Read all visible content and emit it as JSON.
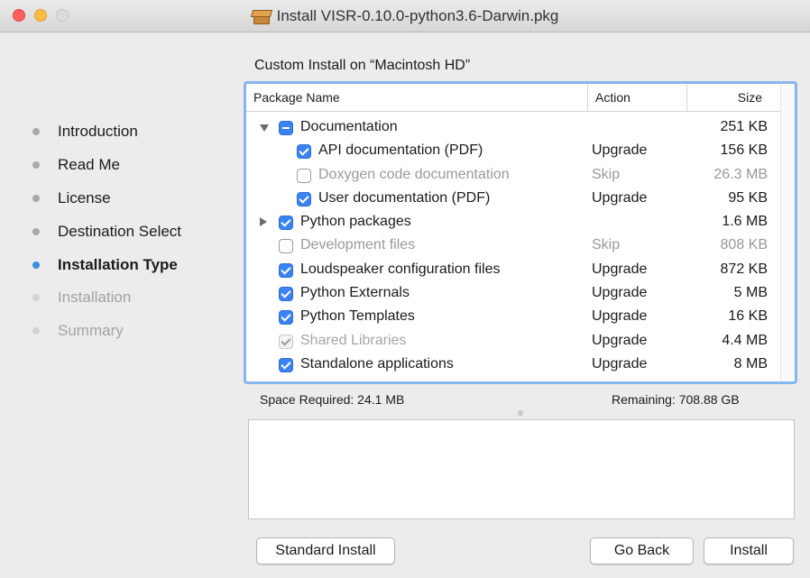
{
  "window": {
    "title": "Install VISR-0.10.0-python3.6-Darwin.pkg",
    "icon": "package-icon"
  },
  "sidebar": {
    "steps": [
      {
        "label": "Introduction",
        "state": "done"
      },
      {
        "label": "Read Me",
        "state": "done"
      },
      {
        "label": "License",
        "state": "done"
      },
      {
        "label": "Destination Select",
        "state": "done"
      },
      {
        "label": "Installation Type",
        "state": "active"
      },
      {
        "label": "Installation",
        "state": "future"
      },
      {
        "label": "Summary",
        "state": "future"
      }
    ]
  },
  "main": {
    "heading": "Custom Install on “Macintosh HD”",
    "columns": {
      "name": "Package Name",
      "action": "Action",
      "size": "Size"
    },
    "rows": [
      {
        "name": "Documentation",
        "action": "",
        "size": "251 KB",
        "check": "mixed",
        "disclosure": "open"
      },
      {
        "name": "API documentation (PDF)",
        "action": "Upgrade",
        "size": "156 KB",
        "check": "on"
      },
      {
        "name": "Doxygen code documentation",
        "action": "Skip",
        "size": "26.3 MB",
        "check": "off"
      },
      {
        "name": "User documentation (PDF)",
        "action": "Upgrade",
        "size": "95 KB",
        "check": "on"
      },
      {
        "name": "Python packages",
        "action": "",
        "size": "1.6 MB",
        "check": "on",
        "disclosure": "closed"
      },
      {
        "name": "Development files",
        "action": "Skip",
        "size": "808 KB",
        "check": "off"
      },
      {
        "name": "Loudspeaker configuration files",
        "action": "Upgrade",
        "size": "872 KB",
        "check": "on"
      },
      {
        "name": "Python Externals",
        "action": "Upgrade",
        "size": "5 MB",
        "check": "on"
      },
      {
        "name": "Python Templates",
        "action": "Upgrade",
        "size": "16 KB",
        "check": "on"
      },
      {
        "name": "Shared Libraries",
        "action": "Upgrade",
        "size": "4.4 MB",
        "check": "disabled"
      },
      {
        "name": "Standalone applications",
        "action": "Upgrade",
        "size": "8 MB",
        "check": "on"
      }
    ],
    "space_required": "Space Required:  24.1 MB",
    "remaining": "Remaining:  708.88 GB"
  },
  "buttons": {
    "standard_install": "Standard Install",
    "go_back": "Go Back",
    "install": "Install"
  }
}
